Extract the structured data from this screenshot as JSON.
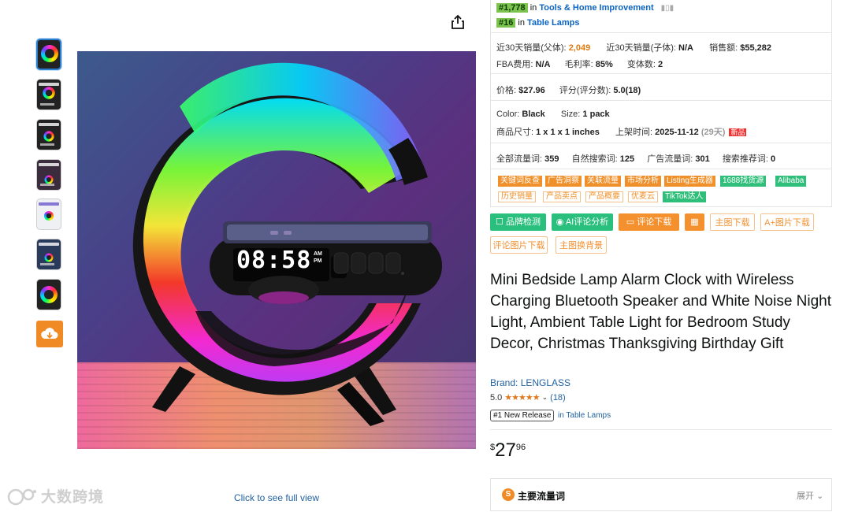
{
  "ranks": [
    {
      "rank": "#1,778",
      "in": "in",
      "category": "Tools & Home Improvement"
    },
    {
      "rank": "#16",
      "in": "in",
      "category": "Table Lamps"
    }
  ],
  "stats": {
    "sales_parent_label": "近30天销量(父体):",
    "sales_parent": "2,049",
    "sales_child_label": "近30天销量(子体):",
    "sales_child": "N/A",
    "revenue_label": "销售额:",
    "revenue": "$55,282",
    "fba_label": "FBA费用:",
    "fba": "N/A",
    "margin_label": "毛利率:",
    "margin": "85%",
    "variants_label": "变体数:",
    "variants": "2",
    "price_label": "价格:",
    "price": "$27.96",
    "rating_label": "评分(评分数):",
    "rating": "5.0(18)",
    "color_label": "Color:",
    "color": "Black",
    "size_label": "Size:",
    "size": "1 pack",
    "dims_label": "商品尺寸:",
    "dims": "1 x 1 x 1 inches",
    "listed_label": "上架时间:",
    "listed": "2025-11-12",
    "listed_days": "(29天)",
    "new_badge": "新品",
    "all_traffic_label": "全部流量词:",
    "all_traffic": "359",
    "organic_label": "自然搜索词:",
    "organic": "125",
    "ad_label": "广告流量词:",
    "ad": "301",
    "recommend_label": "搜索推荐词:",
    "recommend": "0"
  },
  "tags_row1": [
    "关键词反查",
    "广告洞察",
    "关联流量",
    "市场分析",
    "Listing生成器",
    "1688找货源",
    "Alibaba"
  ],
  "tags_row2": [
    "历史销量",
    "产品卖点",
    "产品概要",
    "优麦云",
    "TikTok达人"
  ],
  "buttons_row1": [
    "品牌检测",
    "AI评论分析",
    "评论下载",
    "主图下载",
    "A+图片下载"
  ],
  "buttons_row2": [
    "评论图片下载",
    "主图换背景"
  ],
  "product": {
    "title": "Mini Bedside Lamp Alarm Clock with Wireless Charging Bluetooth Speaker and White Noise Night Light, Ambient Table Light for Bedroom Study Decor, Christmas Thanksgiving Birthday Gift",
    "brand": "Brand: LENGLASS",
    "rating_value": "5.0",
    "stars": "★★★★★",
    "rating_count": "(18)",
    "badge": "#1 New Release",
    "badge_category": "in Table Lamps",
    "price_symbol": "$",
    "price_whole": "27",
    "price_cents": "96"
  },
  "clock_display": "08:58",
  "clock_ampm": [
    "AM",
    "PM"
  ],
  "click_full_view": "Click to see full view",
  "watermark": "大数跨境",
  "keywords_section": {
    "title": "主要流量词",
    "toggle": "展开"
  }
}
